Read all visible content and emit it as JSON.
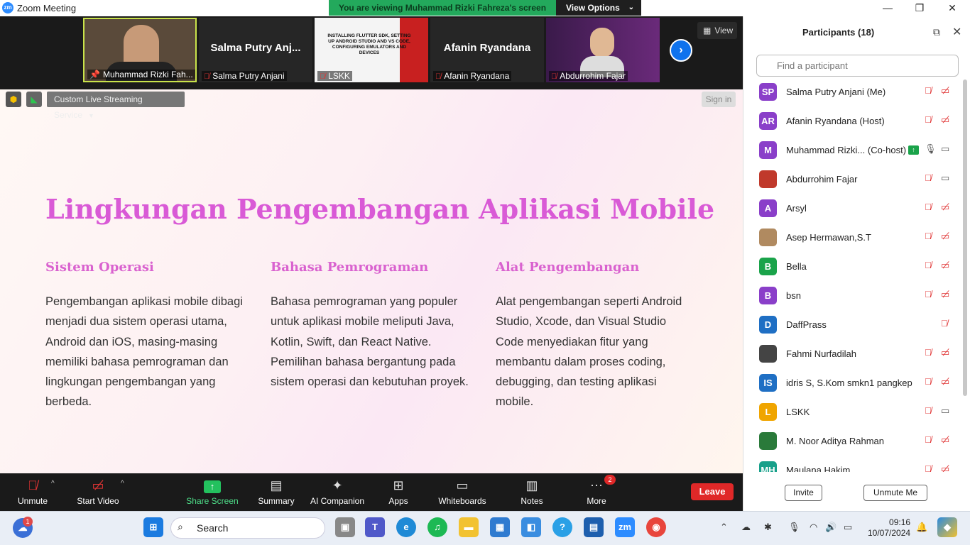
{
  "window": {
    "title": "Zoom Meeting",
    "minimize": "—",
    "maximize": "❐",
    "close": "✕"
  },
  "banner": {
    "text": "You are viewing Muhammad Rizki Fahreza's screen",
    "view_options": "View Options"
  },
  "video_strip": {
    "tiles": [
      {
        "label": "Muhammad Rizki Fah..."
      },
      {
        "big": "Salma Putry Anj...",
        "label": "Salma Putry Anjani"
      },
      {
        "label": "LSKK",
        "slide_text": "INSTALLING FLUTTER SDK, SETTING UP ANDROID STUDIO AND VS CODE, CONFIGURING EMULATORS AND DEVICES"
      },
      {
        "big": "Afanin Ryandana",
        "label": "Afanin Ryandana"
      },
      {
        "label": "Abdurrohim Fajar"
      }
    ],
    "view_label": "View"
  },
  "share_toolbar": {
    "live_service": "Custom Live Streaming Service",
    "sign_in": "Sign in"
  },
  "slide": {
    "title": "Lingkungan Pengembangan Aplikasi Mobile",
    "columns": [
      {
        "heading": "Sistem Operasi",
        "body": "Pengembangan aplikasi mobile dibagi menjadi dua sistem operasi utama, Android dan iOS, masing-masing memiliki bahasa pemrograman dan lingkungan pengembangan yang berbeda."
      },
      {
        "heading": "Bahasa Pemrograman",
        "body": "Bahasa pemrograman yang populer untuk aplikasi mobile meliputi Java, Kotlin, Swift, dan React Native. Pemilihan bahasa bergantung pada sistem operasi dan kebutuhan proyek."
      },
      {
        "heading": "Alat Pengembangan",
        "body": "Alat pengembangan seperti Android Studio, Xcode, dan Visual Studio Code menyediakan fitur yang membantu dalam proses coding, debugging, dan testing aplikasi mobile."
      }
    ]
  },
  "meeting_toolbar": {
    "unmute": "Unmute",
    "start_video": "Start Video",
    "share_screen": "Share Screen",
    "summary": "Summary",
    "ai_companion": "AI Companion",
    "apps": "Apps",
    "whiteboards": "Whiteboards",
    "notes": "Notes",
    "more": "More",
    "more_badge": "2",
    "leave": "Leave"
  },
  "participants": {
    "title": "Participants (18)",
    "search_placeholder": "Find a participant",
    "list": [
      {
        "initials": "SP",
        "name": "Salma Putry Anjani (Me)",
        "color": "#8a3fc9"
      },
      {
        "initials": "AR",
        "name": "Afanin Ryandana (Host)",
        "color": "#8a3fc9"
      },
      {
        "initials": "M",
        "name": "Muhammad Rizki... (Co-host)",
        "color": "#8a3fc9"
      },
      {
        "initials": "",
        "name": "Abdurrohim Fajar",
        "color": "#c0392b"
      },
      {
        "initials": "A",
        "name": "Arsyl",
        "color": "#8a3fc9"
      },
      {
        "initials": "",
        "name": "Asep Hermawan,S.T",
        "color": "#b08a60"
      },
      {
        "initials": "B",
        "name": "Bella",
        "color": "#1aa34a"
      },
      {
        "initials": "B",
        "name": "bsn",
        "color": "#8a3fc9"
      },
      {
        "initials": "D",
        "name": "DaffPrass",
        "color": "#1f6fc4"
      },
      {
        "initials": "",
        "name": "Fahmi Nurfadilah",
        "color": "#444444"
      },
      {
        "initials": "IS",
        "name": "idris S, S.Kom smkn1 pangkep",
        "color": "#1f6fc4"
      },
      {
        "initials": "L",
        "name": "LSKK",
        "color": "#f0a500"
      },
      {
        "initials": "",
        "name": "M. Noor Aditya Rahman",
        "color": "#2a7a3a"
      },
      {
        "initials": "MH",
        "name": "Maulana Hakim",
        "color": "#17a08a"
      }
    ],
    "invite": "Invite",
    "unmute_me": "Unmute Me"
  },
  "taskbar": {
    "search": "Search",
    "time": "09:16",
    "date": "10/07/2024",
    "notif_badge": "1"
  }
}
